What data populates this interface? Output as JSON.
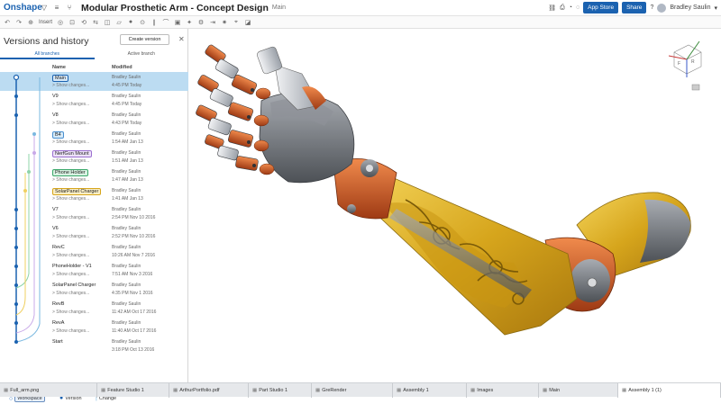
{
  "app": {
    "logo": "Onshape"
  },
  "document": {
    "title": "Modular Prosthetic Arm - Concept Design",
    "branch": "Main"
  },
  "top_right": {
    "app_store": "App Store",
    "share": "Share",
    "user": "Bradley Saulin",
    "help": "?"
  },
  "toolbar": {
    "insert": "Insert"
  },
  "panel": {
    "title": "Versions and history",
    "create_version": "Create version",
    "tabs": [
      "All branches",
      "Active branch"
    ],
    "col_name": "Name",
    "col_modified": "Modified",
    "rows": [
      {
        "name": "Main",
        "show": "> Show changes...",
        "user": "Bradley Saulin",
        "date": "4:45 PM Today",
        "selected": true,
        "tag": "main"
      },
      {
        "name": "V9",
        "show": "> Show changes...",
        "user": "Bradley Saulin",
        "date": "4:45 PM Today"
      },
      {
        "name": "V8",
        "show": "> Show changes...",
        "user": "Bradley Saulin",
        "date": "4:43 PM Today"
      },
      {
        "name": "B4",
        "show": "> Show changes...",
        "user": "Bradley Saulin",
        "date": "1:54 AM Jan 13",
        "tag": "blue"
      },
      {
        "name": "NerfGun Mount",
        "show": "> Show changes...",
        "user": "Bradley Saulin",
        "date": "1:51 AM Jan 13",
        "tag": "purple"
      },
      {
        "name": "Phone Holder",
        "show": "> Show changes...",
        "user": "Bradley Saulin",
        "date": "1:47 AM Jan 13",
        "tag": "green"
      },
      {
        "name": "SolarPanel Charger",
        "show": "> Show changes...",
        "user": "Bradley Saulin",
        "date": "1:41 AM Jan 13",
        "tag": "yellow"
      },
      {
        "name": "V7",
        "show": "> Show changes...",
        "user": "Bradley Saulin",
        "date": "2:54 PM Nov 10 2016"
      },
      {
        "name": "V6",
        "show": "> Show changes...",
        "user": "Bradley Saulin",
        "date": "2:52 PM Nov 10 2016"
      },
      {
        "name": "RevC",
        "show": "> Show changes...",
        "user": "Bradley Saulin",
        "date": "10:26 AM Nov 7 2016"
      },
      {
        "name": "PhoneHolder - V1",
        "show": "> Show changes...",
        "user": "Bradley Saulin",
        "date": "7:51 AM Nov 3 2016"
      },
      {
        "name": "SolarPanel Charger",
        "show": "> Show changes...",
        "user": "Bradley Saulin",
        "date": "4:35 PM Nov 1 2016"
      },
      {
        "name": "RevB",
        "show": "> Show changes...",
        "user": "Bradley Saulin",
        "date": "11:42 AM Oct 17 2016"
      },
      {
        "name": "RevA",
        "show": "> Show changes...",
        "user": "Bradley Saulin",
        "date": "11:40 AM Oct 17 2016"
      },
      {
        "name": "Start",
        "show": "",
        "user": "Bradley Saulin",
        "date": "3:18 PM Oct 13 2016"
      }
    ],
    "legend": {
      "workspace": "Workspace",
      "version": "Version",
      "change": "Change"
    }
  },
  "bottom_tabs": [
    {
      "label": "Full_arm.png",
      "width": 108
    },
    {
      "label": "Feature Studio 1",
      "width": 80
    },
    {
      "label": "ArthurPortfolio.pdf",
      "width": 88
    },
    {
      "label": "Part Studio 1",
      "width": 70
    },
    {
      "label": "GreRender",
      "width": 90
    },
    {
      "label": "Assembly 1",
      "width": 82
    },
    {
      "label": "Images",
      "width": 80
    },
    {
      "label": "Main",
      "width": 88
    },
    {
      "label": "Assembly 1 (1)",
      "width": 114,
      "active": true
    }
  ],
  "colors": {
    "brand": "#1b62b0",
    "selected_row": "#bcdcf2",
    "copper": "#c85a2a",
    "gold": "#d4a41a",
    "gunmetal": "#6f7378"
  }
}
